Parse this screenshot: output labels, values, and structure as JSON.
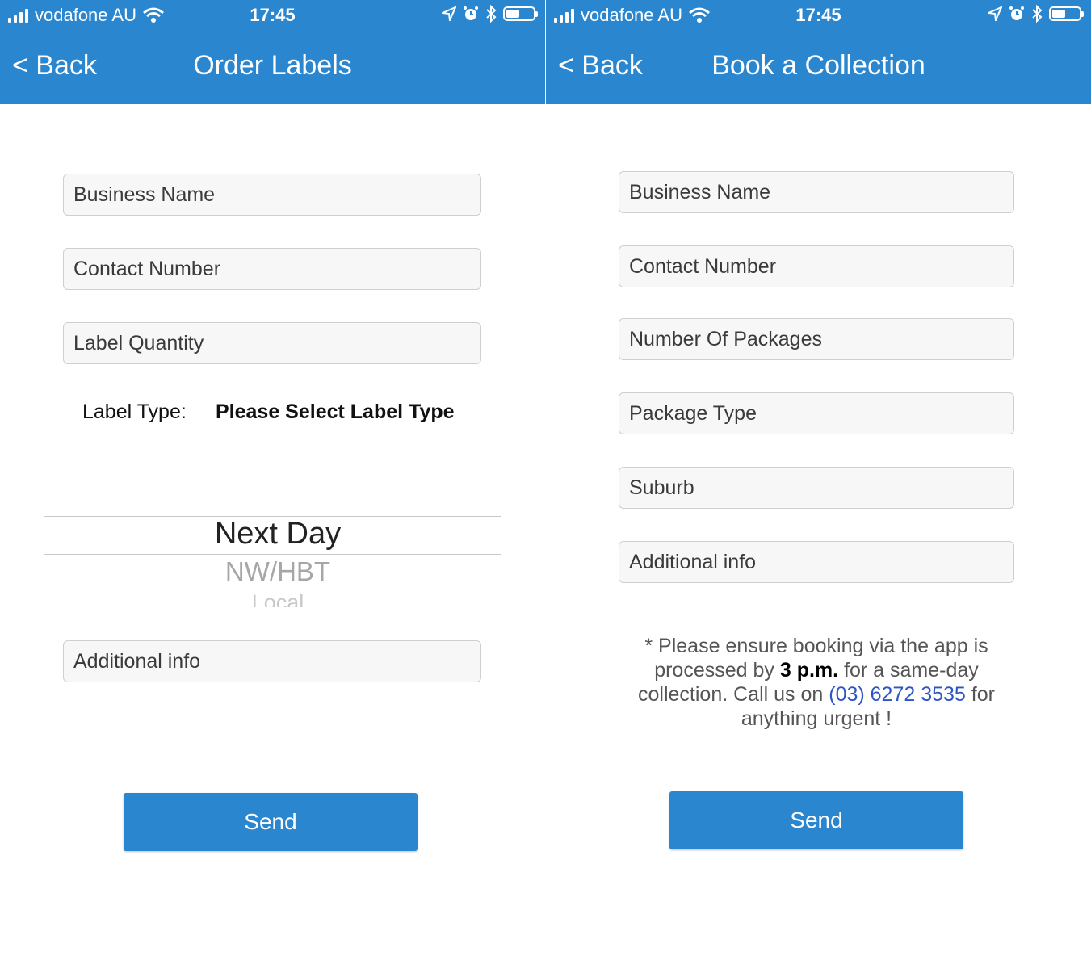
{
  "status": {
    "carrier": "vodafone AU",
    "time": "17:45",
    "battery_level": 0.5
  },
  "left_screen": {
    "back_label": "< Back",
    "title": "Order Labels",
    "fields": {
      "business_name": "Business Name",
      "contact_number": "Contact Number",
      "label_quantity": "Label Quantity",
      "additional_info": "Additional info"
    },
    "label_type": {
      "label": "Label Type:",
      "value": "Please Select Label Type"
    },
    "picker": {
      "options": [
        "Next Day",
        "NW/HBT",
        "Local"
      ],
      "selected": "Next Day"
    },
    "send_label": "Send"
  },
  "right_screen": {
    "back_label": "< Back",
    "title": "Book a Collection",
    "fields": {
      "business_name": "Business Name",
      "contact_number": "Contact Number",
      "number_of_packages": "Number Of Packages",
      "package_type": "Package Type",
      "suburb": "Suburb",
      "additional_info": "Additional info"
    },
    "note": {
      "part1": "* Please ensure booking via the app is processed by ",
      "emphasis": "3 p.m.",
      "part2": " for a same-day collection. Call us on ",
      "phone": "(03) 6272 3535",
      "part3": " for anything urgent !"
    },
    "send_label": "Send"
  },
  "colors": {
    "accent": "#2b86d0",
    "link": "#2d55c6"
  }
}
